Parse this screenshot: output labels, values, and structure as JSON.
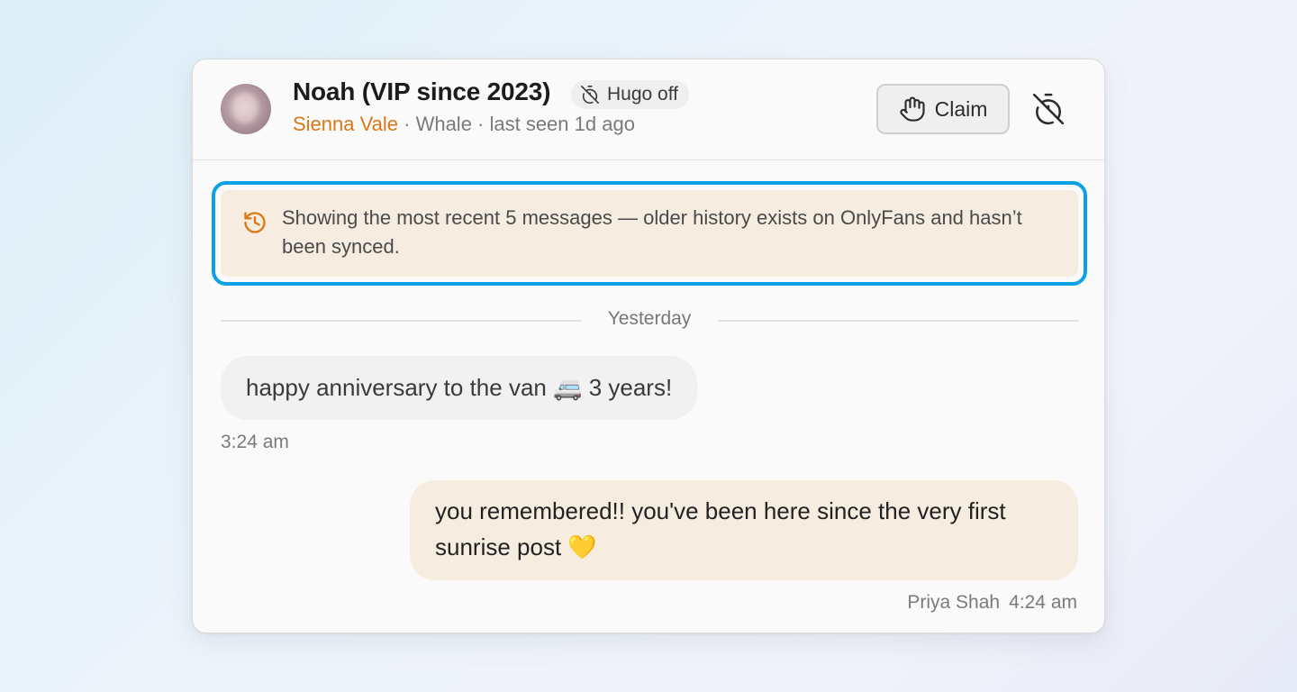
{
  "header": {
    "fan_name": "Noah (VIP since 2023)",
    "hugo_status": "Hugo off",
    "creator_name": "Sienna Vale",
    "subline_rest": " · Whale · last seen 1d ago",
    "claim_label": "Claim"
  },
  "notice": {
    "text": "Showing the most recent 5 messages — older history exists on OnlyFans and hasn’t been synced."
  },
  "divider_label": "Yesterday",
  "messages": [
    {
      "direction": "incoming",
      "text": "happy anniversary to the van 🚐 3 years!",
      "time": "3:24 am"
    },
    {
      "direction": "outgoing",
      "text": "you remembered!! you've been here since the very first sunrise post 💛",
      "sender": "Priya Shah",
      "time": "4:24 am"
    }
  ],
  "colors": {
    "accent_creator": "#d97814",
    "highlight_outline": "#0aa2e4",
    "notice_bg": "#f6ede0"
  },
  "icons": {
    "hugo": "timer-off-icon",
    "claim": "hand-icon",
    "header_action": "timer-off-icon",
    "notice": "history-icon"
  }
}
